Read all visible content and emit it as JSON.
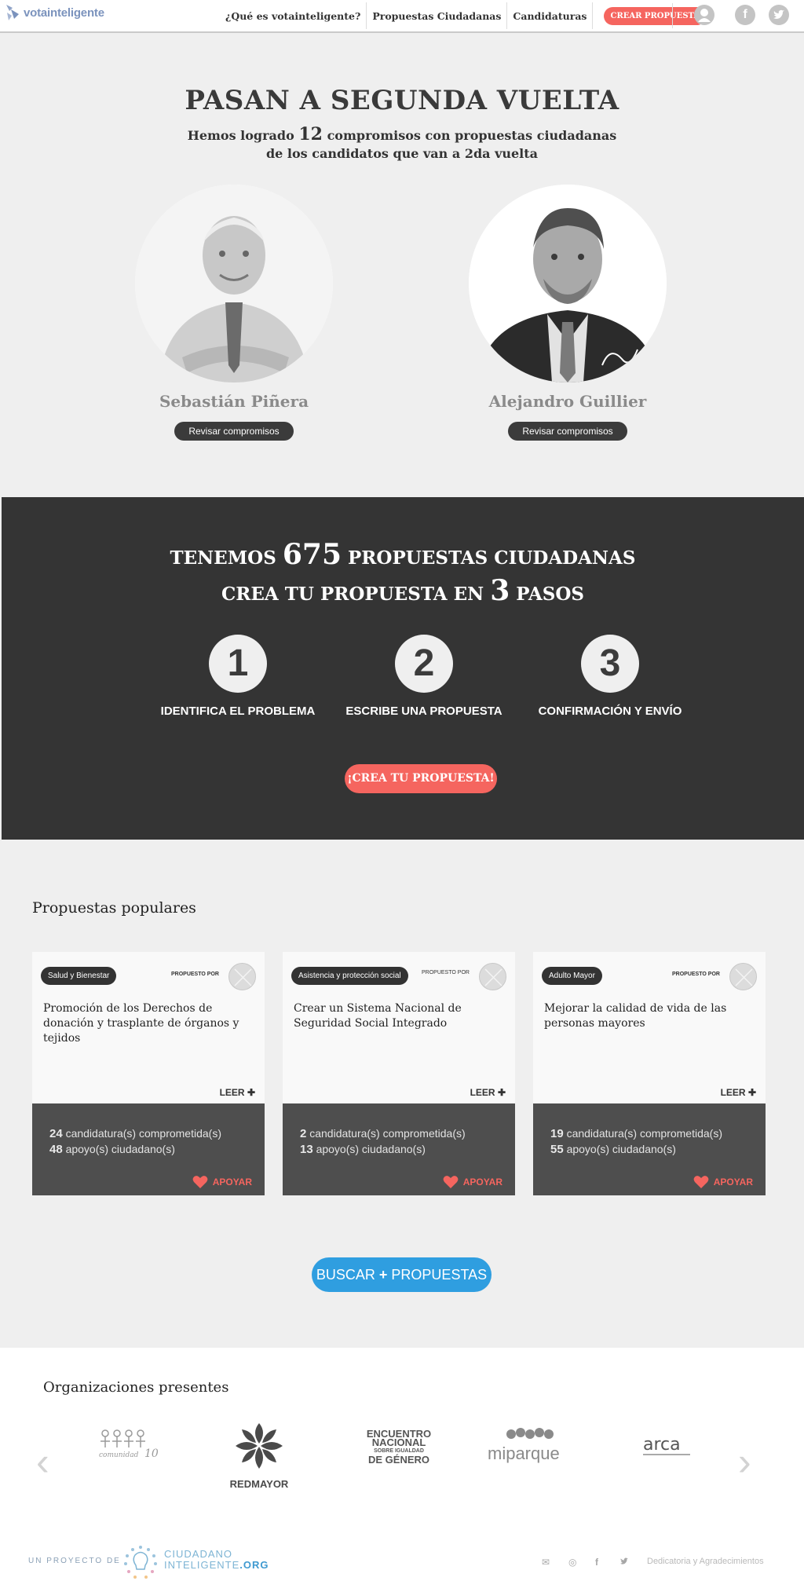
{
  "nav": {
    "logo": "votainteligente",
    "links": [
      "¿Qué es votainteligente?",
      "Propuestas Ciudadanas",
      "Candidaturas"
    ],
    "cta": "CREAR PROPUESTA",
    "icons": [
      "user-icon",
      "facebook-icon",
      "twitter-icon"
    ]
  },
  "hero": {
    "title": "PASAN A SEGUNDA VUELTA",
    "subtitle_pre": "Hemos logrado",
    "subtitle_num": "12",
    "subtitle_post": "compromisos con propuestas ciudadanas",
    "subtitle_line2": "de los candidatos que van a 2da vuelta",
    "candidates": [
      {
        "name": "Sebastián Piñera",
        "button": "Revisar compromisos"
      },
      {
        "name": "Alejandro Guillier",
        "button": "Revisar compromisos"
      }
    ]
  },
  "band": {
    "line1_pre": "TENEMOS",
    "line1_num": "675",
    "line1_post": "PROPUESTAS CIUDADANAS",
    "line2_pre": "CREA TU PROPUESTA EN",
    "line2_num": "3",
    "line2_post": "PASOS",
    "steps": [
      {
        "num": "1",
        "label": "IDENTIFICA EL PROBLEMA"
      },
      {
        "num": "2",
        "label": "ESCRIBE UNA PROPUESTA"
      },
      {
        "num": "3",
        "label": "CONFIRMACIÓN Y ENVÍO"
      }
    ],
    "cta": "¡CREA TU PROPUESTA!"
  },
  "popular": {
    "title": "Propuestas populares",
    "cards": [
      {
        "tag": "Salud y Bienestar",
        "by": "PROPUESTO POR",
        "title": "Promoción de los Derechos de donación y trasplante de órganos y tejidos",
        "leer": "LEER",
        "candidaturas": "24",
        "candidaturas_label": "candidatura(s) comprometida(s)",
        "apoyos": "48",
        "apoyos_label": "apoyo(s) ciudadano(s)",
        "apoyar": "APOYAR"
      },
      {
        "tag": "Asistencia y protección social",
        "by": "PROPUESTO POR",
        "title": "Crear un Sistema Nacional de Seguridad Social Integrado",
        "leer": "LEER",
        "candidaturas": "2",
        "candidaturas_label": "candidatura(s) comprometida(s)",
        "apoyos": "13",
        "apoyos_label": "apoyo(s) ciudadano(s)",
        "apoyar": "APOYAR"
      },
      {
        "tag": "Adulto Mayor",
        "by": "PROPUESTO POR",
        "title": "Mejorar la calidad de vida de las personas mayores",
        "leer": "LEER",
        "candidaturas": "19",
        "candidaturas_label": "candidatura(s) comprometida(s)",
        "apoyos": "55",
        "apoyos_label": "apoyo(s) ciudadano(s)",
        "apoyar": "APOYAR"
      }
    ],
    "search_pre": "BUSCAR",
    "search_plus": "+",
    "search_post": "PROPUESTAS"
  },
  "orgs": {
    "title": "Organizaciones presentes",
    "logos": [
      "comunidad 10",
      "REDMAYOR",
      "ENCUENTRO NACIONAL SOBRE IGUALDAD DE GÉNERO",
      "miparque",
      "arca"
    ],
    "enc_l1": "ENCUENTRO",
    "enc_l2": "NACIONAL",
    "enc_l3": "SOBRE IGUALDAD",
    "enc_l4": "DE GÉNERO"
  },
  "footer": {
    "proyecto": "UN PROYECTO DE",
    "ci_line1": "CIUDADANO",
    "ci_line2": "INTELIGENTE",
    "ci_tld": ".ORG",
    "link": "Dedicatoria y Agradecimientos",
    "icons": [
      "mail-icon",
      "github-icon",
      "facebook-icon",
      "twitter-icon"
    ]
  },
  "colors": {
    "accent": "#f5655f",
    "dark": "#343434",
    "blue": "#2f9ee0",
    "background": "#efefef"
  }
}
